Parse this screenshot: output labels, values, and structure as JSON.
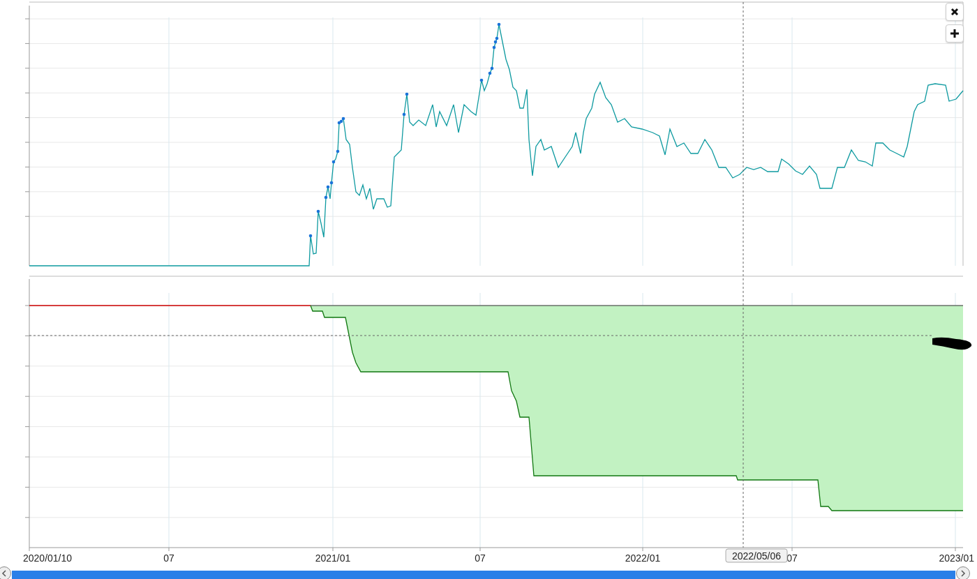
{
  "x_axis": {
    "ticks": [
      "2020/01/10",
      "07",
      "2021/01",
      "07",
      "2022/01",
      "07",
      "2023/01"
    ]
  },
  "crosshair": {
    "label": "2022/05/06"
  }
}
